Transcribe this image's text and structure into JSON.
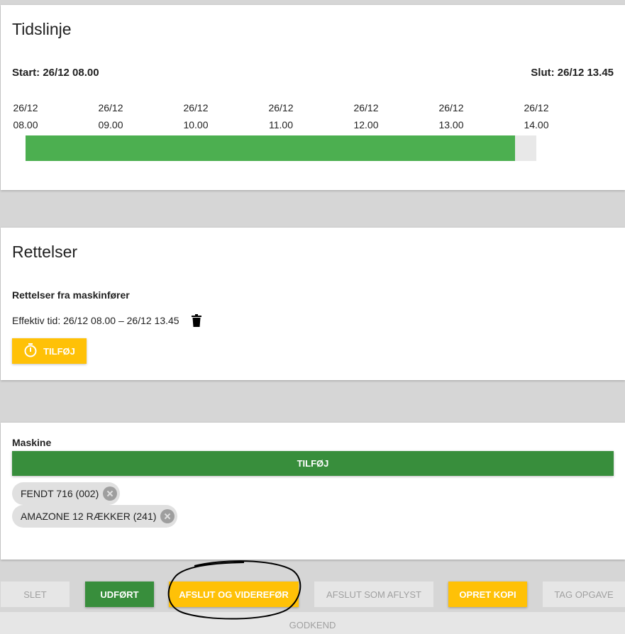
{
  "timeline": {
    "title": "Tidslinje",
    "start_label": "Start: 26/12 08.00",
    "end_label": "Slut: 26/12 13.45",
    "ticks": [
      {
        "date": "26/12",
        "time": "08.00"
      },
      {
        "date": "26/12",
        "time": "09.00"
      },
      {
        "date": "26/12",
        "time": "10.00"
      },
      {
        "date": "26/12",
        "time": "11.00"
      },
      {
        "date": "26/12",
        "time": "12.00"
      },
      {
        "date": "26/12",
        "time": "13.00"
      },
      {
        "date": "26/12",
        "time": "14.00"
      }
    ],
    "progress_fraction": 0.958,
    "fill_color": "#4caf50"
  },
  "corrections": {
    "title": "Rettelser",
    "subheading": "Rettelser fra maskinfører",
    "effective_time": "Effektiv tid: 26/12 08.00 – 26/12 13.45",
    "delete_icon": "trash-icon",
    "add_label": "TILFØJ",
    "add_icon": "timer-icon"
  },
  "machine": {
    "subheading": "Maskine",
    "add_label": "TILFØJ",
    "chips": [
      {
        "label": "FENDT 716 (002)"
      },
      {
        "label": "AMAZONE 12 RÆKKER (241)"
      }
    ]
  },
  "actions": {
    "delete": "SLET",
    "done": "UDFØRT",
    "finish_continue": "AFSLUT OG VIDEREFØR",
    "finish_cancelled": "AFSLUT SOM AFLYST",
    "create_copy": "OPRET KOPI",
    "take_task": "TAG OPGAVE",
    "approve": "GODKEND"
  },
  "colors": {
    "primary_green": "#388e3c",
    "accent_yellow": "#ffc107",
    "disabled_grey": "#e6e6e6"
  }
}
